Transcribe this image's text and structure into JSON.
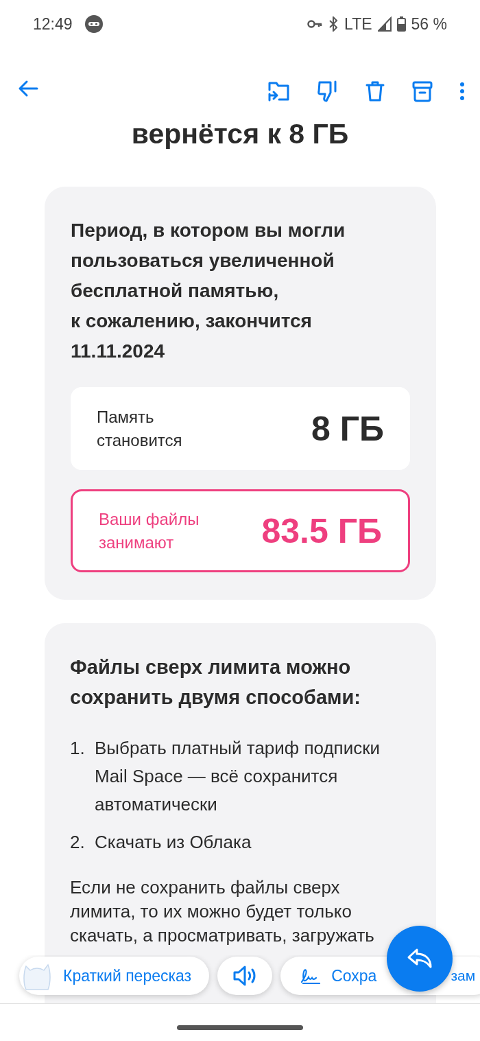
{
  "status_bar": {
    "time": "12:49",
    "network": "LTE",
    "battery": "56 %"
  },
  "heading": "вернётся к 8 ГБ",
  "notice_card": {
    "text": "Период, в котором вы могли пользоваться увеличенной бесплатной памятью,\nк сожалению, закончится 11.11.2024",
    "stats": [
      {
        "kind": "normal",
        "label": "Память становится",
        "value": "8 ГБ"
      },
      {
        "kind": "alert",
        "label": "Ваши файлы занимают",
        "value": "83.5 ГБ"
      }
    ]
  },
  "options_card": {
    "title": "Файлы сверх лимита можно сохранить двумя способами:",
    "steps": [
      {
        "number": "1.",
        "text": "Выбрать платный тариф подписки Mail Space — всё сохранится автоматически"
      },
      {
        "number": "2.",
        "text": "Скачать из Облака"
      }
    ],
    "note": "Если не сохранить файлы сверх лимита, то их можно будет только скачать, а просматривать, загружать"
  },
  "action_chips": [
    {
      "kind": "summary",
      "label": "Краткий пересказ"
    },
    {
      "kind": "listen"
    },
    {
      "kind": "save",
      "label": "Сохра",
      "label_tail": "зам"
    }
  ]
}
